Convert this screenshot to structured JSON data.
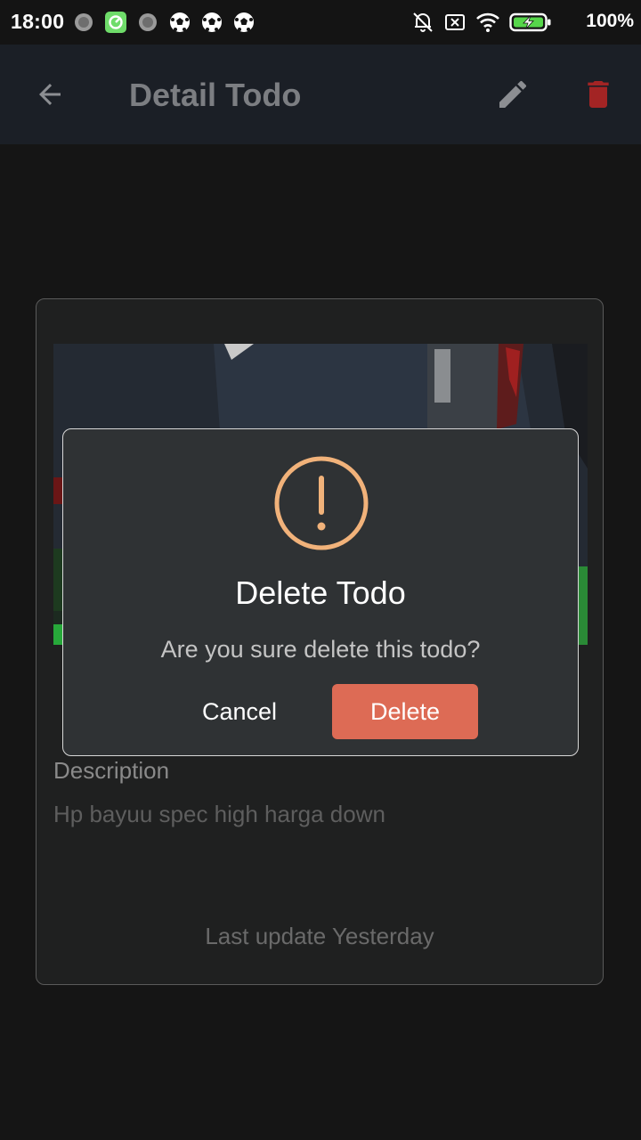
{
  "status_bar": {
    "time": "18:00",
    "battery_percent": "100%",
    "notification_icons": [
      "loading-icon",
      "app-notification-icon",
      "loading-icon",
      "soccer-ball-icon",
      "soccer-ball-icon",
      "soccer-ball-icon"
    ],
    "system_icons": [
      "alarm-off-icon",
      "no-sim-icon",
      "wifi-icon",
      "battery-charging-icon"
    ]
  },
  "app_bar": {
    "title": "Detail Todo",
    "back_icon": "arrow-back-icon",
    "edit_icon": "pencil-icon",
    "delete_icon": "trash-icon"
  },
  "detail": {
    "description_label": "Description",
    "description_value": "Hp bayuu spec high harga down",
    "last_update": "Last update Yesterday"
  },
  "dialog": {
    "icon": "warning-icon",
    "title": "Delete Todo",
    "message": "Are you sure delete this todo?",
    "cancel_label": "Cancel",
    "confirm_label": "Delete"
  },
  "colors": {
    "background": "#151515",
    "app_bar": "#1b1f26",
    "title_text": "#7c7e82",
    "trash_icon": "#a32424",
    "dialog_background": "#2f3234",
    "warning_accent": "#f1b27a",
    "confirm_button": "#dd6b55"
  }
}
